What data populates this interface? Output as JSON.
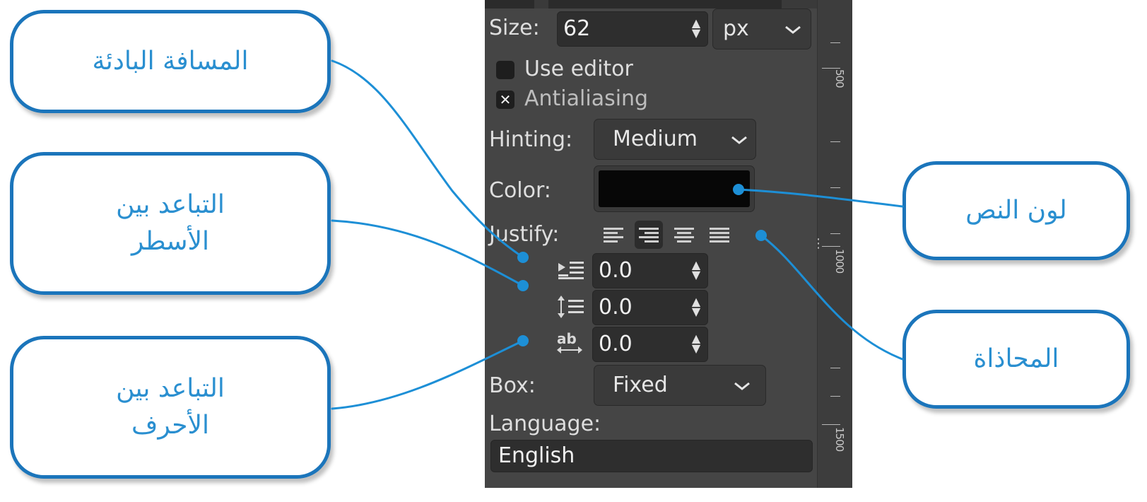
{
  "callouts": {
    "indent": {
      "text": "المسافة البادئة"
    },
    "line_spacing": {
      "line1": "التباعد بين",
      "line2": "الأسطر"
    },
    "letter_spacing": {
      "line1": "التباعد بين",
      "line2": "الأحرف"
    },
    "text_color": {
      "text": "لون النص"
    },
    "justify": {
      "text": "المحاذاة"
    }
  },
  "panel": {
    "size": {
      "label": "Size:",
      "value": "62",
      "unit": "px"
    },
    "use_editor": {
      "label": "Use editor",
      "checked": false
    },
    "antialiasing": {
      "label": "Antialiasing",
      "checked": true,
      "mark": "✕"
    },
    "hinting": {
      "label": "Hinting:",
      "value": "Medium"
    },
    "color": {
      "label": "Color:",
      "swatch": "#070707"
    },
    "justify": {
      "label": "Justify:",
      "options": [
        "left",
        "right",
        "center",
        "fill"
      ],
      "selected": "right"
    },
    "indent": {
      "value": "0.0"
    },
    "line_spacing": {
      "value": "0.0"
    },
    "letter_spacing": {
      "value": "0.0"
    },
    "box": {
      "label": "Box:",
      "value": "Fixed"
    },
    "language": {
      "label": "Language:",
      "value": "English"
    },
    "ruler_labels": [
      "500",
      "1000",
      "1500"
    ]
  },
  "colors": {
    "callout_border": "#1b75bb",
    "callout_text": "#2a8fd0",
    "leader": "#1d8fd6",
    "panel_bg": "#454545"
  }
}
